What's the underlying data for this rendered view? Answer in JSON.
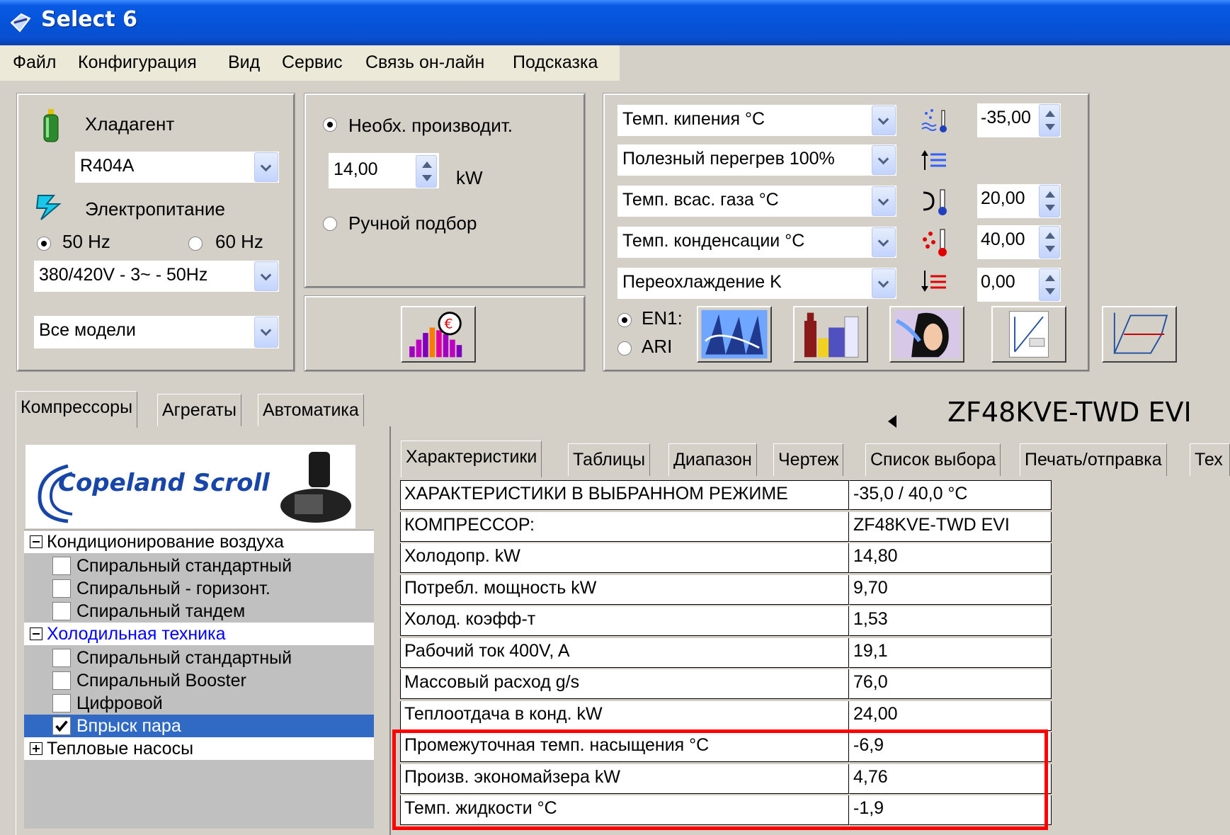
{
  "window": {
    "title": "Select 6"
  },
  "menu": [
    "Файл",
    "Конфигурация",
    "Вид",
    "Сервис",
    "Связь он-лайн",
    "Подсказка"
  ],
  "refrigerant": {
    "label": "Хладагент",
    "value": "R404A",
    "power_label": "Электропитание",
    "hz50": "50 Hz",
    "hz60": "60 Hz",
    "voltage": "380/420V - 3~ - 50Hz",
    "models": "Все модели"
  },
  "capacity": {
    "required_label": "Необх. производит.",
    "value": "14,00",
    "unit": "kW",
    "manual_label": "Ручной подбор"
  },
  "conditions": {
    "rows": [
      {
        "label": "Темп. кипения °C",
        "value": "-35,00"
      },
      {
        "label": "Полезный перегрев 100%",
        "value": ""
      },
      {
        "label": "Темп. всас. газа °C",
        "value": "20,00"
      },
      {
        "label": "Темп. конденсации °C",
        "value": "40,00"
      },
      {
        "label": "Переохлаждение K",
        "value": "0,00"
      }
    ],
    "en": "EN1:",
    "ari": "ARI"
  },
  "left_tabs": [
    "Компрессоры",
    "Агрегаты",
    "Автоматика"
  ],
  "logo_text": "Copeland Scroll",
  "tree": [
    {
      "type": "group",
      "label": "Кондиционирование воздуха",
      "sign": "−"
    },
    {
      "type": "item",
      "label": "Спиральный стандартный",
      "checked": false
    },
    {
      "type": "item",
      "label": "Спиральный - горизонт.",
      "checked": false
    },
    {
      "type": "item",
      "label": "Спиральный тандем",
      "checked": false
    },
    {
      "type": "group",
      "label": "Холодильная техника",
      "sign": "−",
      "color": "#0000ff"
    },
    {
      "type": "item",
      "label": "Спиральный стандартный",
      "checked": false
    },
    {
      "type": "item",
      "label": "Спиральный Booster",
      "checked": false
    },
    {
      "type": "item",
      "label": "Цифровой",
      "checked": false
    },
    {
      "type": "item",
      "label": "Впрыск пара",
      "checked": true,
      "selected": true
    },
    {
      "type": "group",
      "label": "Тепловые насосы",
      "sign": "+"
    }
  ],
  "model": {
    "name": "ZF48KVE-TWD EVI"
  },
  "right_tabs": [
    "Характеристики",
    "Таблицы",
    "Диапазон",
    "Чертеж",
    "Список выбора",
    "Печать/отправка",
    "Тех"
  ],
  "results": [
    {
      "key": "ХАРАКТЕРИСТИКИ В ВЫБРАННОМ РЕЖИМЕ",
      "value": "-35,0 / 40,0 °C"
    },
    {
      "key": "КОМПРЕССОР:",
      "value": "ZF48KVE-TWD EVI"
    },
    {
      "key": "Холодопр. kW",
      "value": "14,80"
    },
    {
      "key": "Потребл. мощность kW",
      "value": "9,70"
    },
    {
      "key": "Холод. коэфф-т",
      "value": "1,53"
    },
    {
      "key": "Рабочий ток 400V, A",
      "value": "19,1"
    },
    {
      "key": "Массовый расход g/s",
      "value": "76,0"
    },
    {
      "key": "Теплоотдача в конд. kW",
      "value": "24,00"
    },
    {
      "key": "Промежуточная темп. насыщения °C",
      "value": "-6,9"
    },
    {
      "key": "Произв. экономайзера kW",
      "value": "4,76"
    },
    {
      "key": "Темп. жидкости °C",
      "value": "-1,9"
    }
  ],
  "colors": {
    "highlight": "#ff0000",
    "selection": "#316ac5",
    "titlebar": "#0553d8"
  }
}
